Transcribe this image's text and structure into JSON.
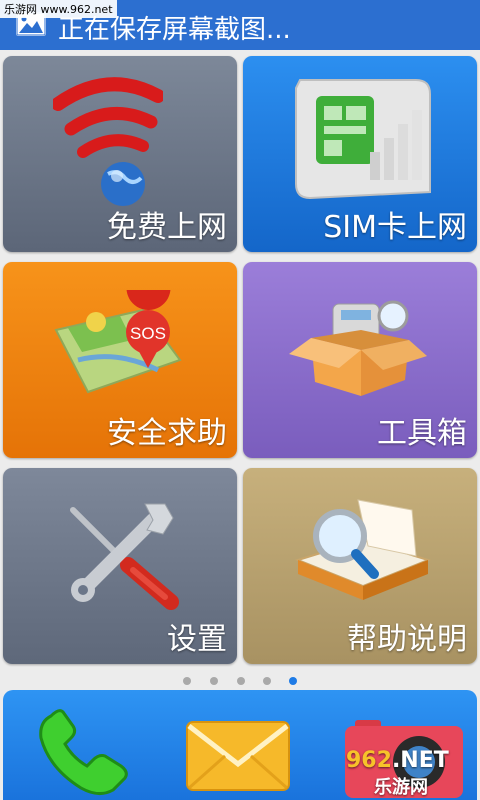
{
  "status_bar": {
    "title": "正在保存屏幕截图...",
    "watermark": "乐游网 www.962.net"
  },
  "tiles": [
    {
      "label": "免费上网",
      "icon": "wifi-globe-icon",
      "color": "#6b7689"
    },
    {
      "label": "SIM卡上网",
      "icon": "sim-card-icon",
      "color": "#1e78dc"
    },
    {
      "label": "安全求助",
      "icon": "sos-map-icon",
      "color": "#ee820f"
    },
    {
      "label": "工具箱",
      "icon": "toolbox-icon",
      "color": "#8a6dcb"
    },
    {
      "label": "设置",
      "icon": "tools-icon",
      "color": "#6b7689"
    },
    {
      "label": "帮助说明",
      "icon": "book-magnifier-icon",
      "color": "#b7a06e"
    }
  ],
  "pager": {
    "pages": 5,
    "current": 5
  },
  "dock": {
    "apps": [
      {
        "icon": "phone-icon"
      },
      {
        "icon": "message-icon"
      },
      {
        "icon": "camera-icon"
      }
    ]
  },
  "watermark_bottom": {
    "a": "962",
    "b": ".NET",
    "c": "乐游网"
  }
}
